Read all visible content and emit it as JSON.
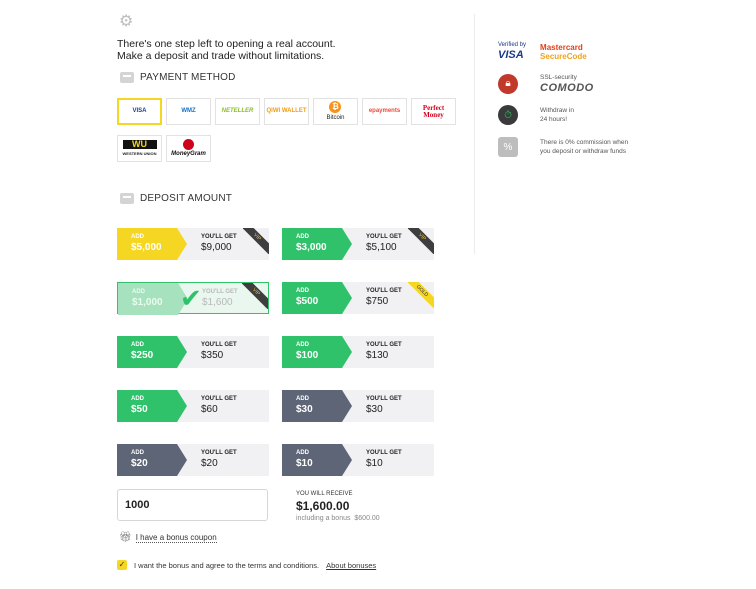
{
  "intro": {
    "line1": "There's one step left to opening a real account.",
    "line2": "Make a deposit and trade without limitations."
  },
  "payment_method": {
    "title": "PAYMENT METHOD",
    "methods": [
      {
        "label": "VISA",
        "color": "#1a3a8a",
        "selected": true
      },
      {
        "label": "WMZ",
        "color": "#1a6fc4"
      },
      {
        "label": "NETELLER",
        "color": "#8cbf26"
      },
      {
        "label": "QIWI WALLET",
        "color": "#f39c12"
      },
      {
        "label": "Bitcoin",
        "color": "#222222"
      },
      {
        "label": "epayments",
        "color": "#e74c3c"
      },
      {
        "label": "Perfect Money",
        "color": "#d0021b"
      },
      {
        "label": "WESTERN UNION",
        "color": "#111111"
      },
      {
        "label": "MoneyGram",
        "color": "#d0021b"
      }
    ]
  },
  "deposit": {
    "title": "DEPOSIT AMOUNT",
    "add_label": "ADD",
    "get_label": "YOU'LL GET",
    "tiles": [
      {
        "add": "$5,000",
        "get": "$9,000",
        "color": "#f5d622",
        "badge": "VIP"
      },
      {
        "add": "$3,000",
        "get": "$5,100",
        "color": "#2fc26a",
        "badge": "VIP"
      },
      {
        "add": "$1,000",
        "get": "$1,600",
        "color": "#2fc26a",
        "badge": "VIP",
        "selected": true
      },
      {
        "add": "$500",
        "get": "$750",
        "color": "#2fc26a",
        "badge": "GOLD"
      },
      {
        "add": "$250",
        "get": "$350",
        "color": "#2fc26a"
      },
      {
        "add": "$100",
        "get": "$130",
        "color": "#2fc26a"
      },
      {
        "add": "$50",
        "get": "$60",
        "color": "#2fc26a"
      },
      {
        "add": "$30",
        "get": "$30",
        "color": "#5e6577"
      },
      {
        "add": "$20",
        "get": "$20",
        "color": "#5e6577"
      },
      {
        "add": "$10",
        "get": "$10",
        "color": "#5e6577"
      }
    ],
    "input_value": "1000",
    "receive_label": "YOU WILL RECEIVE",
    "receive_amount": "$1,600.00",
    "receive_bonus_label": "including a bonus",
    "receive_bonus": "$600.00"
  },
  "coupon_link": "I have a bonus coupon",
  "agree": {
    "text": "I want the bonus and agree to the terms and conditions.",
    "link": "About bonuses",
    "checked": true
  },
  "sidebar": {
    "verified_by": "Verified by",
    "visa": "VISA",
    "mastercard": "Mastercard",
    "securecode": "SecureCode",
    "ssl_label": "SSL-security",
    "comodo": "COMODO",
    "withdraw_line1": "Withdraw in",
    "withdraw_line2": "24 hours!",
    "commission_line1": "There is 0% commission when",
    "commission_line2": "you deposit or withdraw funds"
  }
}
